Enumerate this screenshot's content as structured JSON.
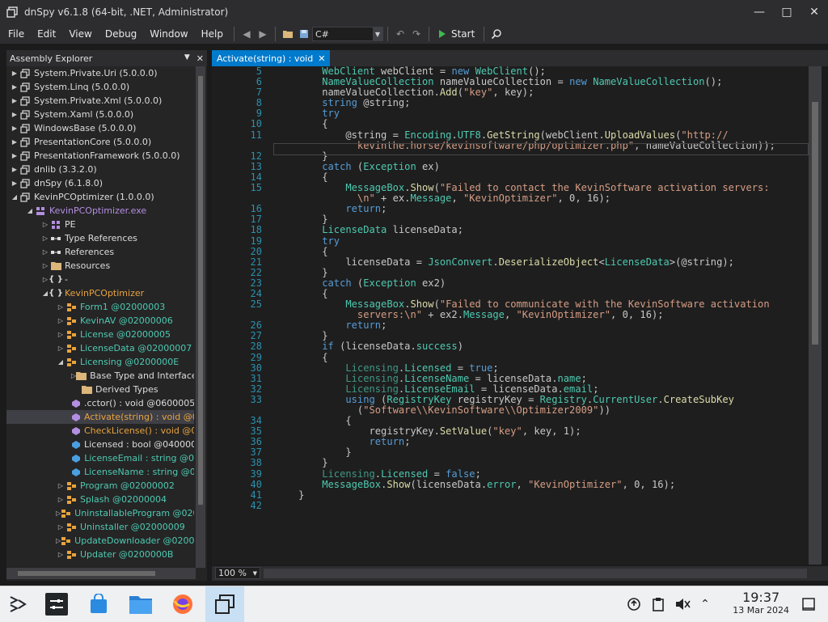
{
  "window": {
    "title": "dnSpy v6.1.8 (64-bit, .NET, Administrator)"
  },
  "menu": [
    "File",
    "Edit",
    "View",
    "Debug",
    "Window",
    "Help"
  ],
  "toolbar": {
    "language": "C#",
    "start_label": "Start"
  },
  "explorer": {
    "title": "Assembly Explorer",
    "items": [
      {
        "label": "System.Private.Uri (5.0.0.0)",
        "depth": 0,
        "arrow": "▶",
        "icon": "assembly-icon",
        "color": "#dcdcdc"
      },
      {
        "label": "System.Linq (5.0.0.0)",
        "depth": 0,
        "arrow": "▶",
        "icon": "assembly-icon",
        "color": "#dcdcdc"
      },
      {
        "label": "System.Private.Xml (5.0.0.0)",
        "depth": 0,
        "arrow": "▶",
        "icon": "assembly-icon",
        "color": "#dcdcdc"
      },
      {
        "label": "System.Xaml (5.0.0.0)",
        "depth": 0,
        "arrow": "▶",
        "icon": "assembly-icon",
        "color": "#dcdcdc"
      },
      {
        "label": "WindowsBase (5.0.0.0)",
        "depth": 0,
        "arrow": "▶",
        "icon": "assembly-icon",
        "color": "#dcdcdc"
      },
      {
        "label": "PresentationCore (5.0.0.0)",
        "depth": 0,
        "arrow": "▶",
        "icon": "assembly-icon",
        "color": "#dcdcdc"
      },
      {
        "label": "PresentationFramework (5.0.0.0)",
        "depth": 0,
        "arrow": "▶",
        "icon": "assembly-icon",
        "color": "#dcdcdc"
      },
      {
        "label": "dnlib (3.3.2.0)",
        "depth": 0,
        "arrow": "▶",
        "icon": "assembly-icon",
        "color": "#dcdcdc"
      },
      {
        "label": "dnSpy (6.1.8.0)",
        "depth": 0,
        "arrow": "▶",
        "icon": "assembly-icon",
        "color": "#dcdcdc"
      },
      {
        "label": "KevinPCOptimizer (1.0.0.0)",
        "depth": 0,
        "arrow": "◢",
        "icon": "assembly-icon",
        "color": "#dcdcdc"
      },
      {
        "label": "KevinPCOptimizer.exe",
        "depth": 1,
        "arrow": "◢",
        "icon": "module-icon",
        "color": "#b48ee0"
      },
      {
        "label": "PE",
        "depth": 2,
        "arrow": "▷",
        "icon": "pe-icon",
        "color": "#dcdcdc"
      },
      {
        "label": "Type References",
        "depth": 2,
        "arrow": "▷",
        "icon": "references-icon",
        "color": "#dcdcdc"
      },
      {
        "label": "References",
        "depth": 2,
        "arrow": "▷",
        "icon": "references-icon",
        "color": "#dcdcdc"
      },
      {
        "label": "Resources",
        "depth": 2,
        "arrow": "▷",
        "icon": "folder-icon",
        "color": "#dcdcdc"
      },
      {
        "label": "-",
        "depth": 2,
        "arrow": "▷",
        "icon": "namespace-icon",
        "color": "#dcdcdc"
      },
      {
        "label": "KevinPCOptimizer",
        "depth": 2,
        "arrow": "◢",
        "icon": "namespace-icon",
        "color": "#e8a33d"
      },
      {
        "label": "Form1 @02000003",
        "depth": 3,
        "arrow": "▷",
        "icon": "class-icon",
        "color": "#4ec9b0"
      },
      {
        "label": "KevinAV @02000006",
        "depth": 3,
        "arrow": "▷",
        "icon": "class-icon",
        "color": "#4ec9b0"
      },
      {
        "label": "License @02000005",
        "depth": 3,
        "arrow": "▷",
        "icon": "class-icon",
        "color": "#4ec9b0"
      },
      {
        "label": "LicenseData @02000007",
        "depth": 3,
        "arrow": "▷",
        "icon": "class-icon",
        "color": "#4ec9b0"
      },
      {
        "label": "Licensing @0200000E",
        "depth": 3,
        "arrow": "◢",
        "icon": "class-icon",
        "color": "#4ec9b0"
      },
      {
        "label": "Base Type and Interfaces",
        "depth": 4,
        "arrow": "▷",
        "icon": "folder-icon",
        "color": "#dcdcdc"
      },
      {
        "label": "Derived Types",
        "depth": 4,
        "arrow": "",
        "icon": "folder-icon",
        "color": "#dcdcdc"
      },
      {
        "label": ".cctor() : void @0600005",
        "depth": 4,
        "arrow": "",
        "icon": "method-icon",
        "color": "#dcdcdc"
      },
      {
        "label": "Activate(string) : void @0",
        "depth": 4,
        "arrow": "",
        "icon": "method-icon",
        "color": "#e8a33d",
        "selected": true
      },
      {
        "label": "CheckLicense() : void @0",
        "depth": 4,
        "arrow": "",
        "icon": "method-icon",
        "color": "#e8a33d"
      },
      {
        "label": "Licensed : bool @040000",
        "depth": 4,
        "arrow": "",
        "icon": "field-icon",
        "color": "#dcdcdc"
      },
      {
        "label": "LicenseEmail : string @0",
        "depth": 4,
        "arrow": "",
        "icon": "field-icon",
        "color": "#4ec9b0"
      },
      {
        "label": "LicenseName : string @0",
        "depth": 4,
        "arrow": "",
        "icon": "field-icon",
        "color": "#4ec9b0"
      },
      {
        "label": "Program @02000002",
        "depth": 3,
        "arrow": "▷",
        "icon": "class-icon",
        "color": "#4ec9b0"
      },
      {
        "label": "Splash @02000004",
        "depth": 3,
        "arrow": "▷",
        "icon": "class-icon",
        "color": "#4ec9b0"
      },
      {
        "label": "UninstallableProgram @0200",
        "depth": 3,
        "arrow": "▷",
        "icon": "class-icon",
        "color": "#4ec9b0"
      },
      {
        "label": "Uninstaller @02000009",
        "depth": 3,
        "arrow": "▷",
        "icon": "class-icon",
        "color": "#4ec9b0"
      },
      {
        "label": "UpdateDownloader @02000",
        "depth": 3,
        "arrow": "▷",
        "icon": "class-icon",
        "color": "#4ec9b0"
      },
      {
        "label": "Updater @0200000B",
        "depth": 3,
        "arrow": "▷",
        "icon": "class-icon",
        "color": "#4ec9b0"
      }
    ]
  },
  "tab": {
    "label": "Activate(string) : void"
  },
  "editor": {
    "line_numbers": [
      "5",
      "6",
      "7",
      "8",
      "9",
      "10",
      "11",
      "",
      "12",
      "13",
      "14",
      "15",
      "",
      "16",
      "17",
      "18",
      "19",
      "20",
      "21",
      "22",
      "23",
      "24",
      "25",
      "",
      "26",
      "27",
      "28",
      "29",
      "30",
      "31",
      "32",
      "33",
      "",
      "34",
      "35",
      "36",
      "37",
      "38",
      "39",
      "40",
      "41",
      "42"
    ],
    "lines": [
      [
        [
          "t",
          "        WebClient"
        ],
        [
          "p",
          " webClient = "
        ],
        [
          "k",
          "new"
        ],
        [
          "p",
          " "
        ],
        [
          "t",
          "WebClient"
        ],
        [
          "p",
          "();"
        ]
      ],
      [
        [
          "t",
          "        NameValueCollection"
        ],
        [
          "p",
          " nameValueCollection = "
        ],
        [
          "k",
          "new"
        ],
        [
          "p",
          " "
        ],
        [
          "t",
          "NameValueCollection"
        ],
        [
          "p",
          "();"
        ]
      ],
      [
        [
          "p",
          "        nameValueCollection."
        ],
        [
          "m",
          "Add"
        ],
        [
          "p",
          "("
        ],
        [
          "s",
          "\"key\""
        ],
        [
          "p",
          ", key);"
        ]
      ],
      [
        [
          "k",
          "        string"
        ],
        [
          "p",
          " @string;"
        ]
      ],
      [
        [
          "k",
          "        try"
        ]
      ],
      [
        [
          "p",
          "        {"
        ]
      ],
      [
        [
          "p",
          "            @string = "
        ],
        [
          "t",
          "Encoding"
        ],
        [
          "p",
          "."
        ],
        [
          "t",
          "UTF8"
        ],
        [
          "p",
          "."
        ],
        [
          "m",
          "GetString"
        ],
        [
          "p",
          "(webClient."
        ],
        [
          "m",
          "UploadValues"
        ],
        [
          "p",
          "("
        ],
        [
          "s",
          "\"http://"
        ]
      ],
      [
        [
          "s",
          "              kevinthe.horse/kevinsoftware/php/optimizer.php\""
        ],
        [
          "p",
          ", nameValueCollection));"
        ]
      ],
      [
        [
          "p",
          "        }"
        ]
      ],
      [
        [
          "k",
          "        catch"
        ],
        [
          "p",
          " ("
        ],
        [
          "t",
          "Exception"
        ],
        [
          "p",
          " ex)"
        ]
      ],
      [
        [
          "p",
          "        {"
        ]
      ],
      [
        [
          "t",
          "            MessageBox"
        ],
        [
          "p",
          "."
        ],
        [
          "m",
          "Show"
        ],
        [
          "p",
          "("
        ],
        [
          "s",
          "\"Failed to contact the KevinSoftware activation servers:"
        ]
      ],
      [
        [
          "s",
          "              \\n\""
        ],
        [
          "p",
          " + ex."
        ],
        [
          "t",
          "Message"
        ],
        [
          "p",
          ", "
        ],
        [
          "s",
          "\"KevinOptimizer\""
        ],
        [
          "p",
          ", 0, 16);"
        ]
      ],
      [
        [
          "k",
          "            return"
        ],
        [
          "p",
          ";"
        ]
      ],
      [
        [
          "p",
          "        }"
        ]
      ],
      [
        [
          "t",
          "        LicenseData"
        ],
        [
          "p",
          " licenseData;"
        ]
      ],
      [
        [
          "k",
          "        try"
        ]
      ],
      [
        [
          "p",
          "        {"
        ]
      ],
      [
        [
          "p",
          "            licenseData = "
        ],
        [
          "t",
          "JsonConvert"
        ],
        [
          "p",
          "."
        ],
        [
          "m",
          "DeserializeObject"
        ],
        [
          "p",
          "<"
        ],
        [
          "t",
          "LicenseData"
        ],
        [
          "p",
          ">(@string);"
        ]
      ],
      [
        [
          "p",
          "        }"
        ]
      ],
      [
        [
          "k",
          "        catch"
        ],
        [
          "p",
          " ("
        ],
        [
          "t",
          "Exception"
        ],
        [
          "p",
          " ex2)"
        ]
      ],
      [
        [
          "p",
          "        {"
        ]
      ],
      [
        [
          "t",
          "            MessageBox"
        ],
        [
          "p",
          "."
        ],
        [
          "m",
          "Show"
        ],
        [
          "p",
          "("
        ],
        [
          "s",
          "\"Failed to communicate with the KevinSoftware activation"
        ]
      ],
      [
        [
          "s",
          "              servers:\\n\""
        ],
        [
          "p",
          " + ex2."
        ],
        [
          "t",
          "Message"
        ],
        [
          "p",
          ", "
        ],
        [
          "s",
          "\"KevinOptimizer\""
        ],
        [
          "p",
          ", 0, 16);"
        ]
      ],
      [
        [
          "k",
          "            return"
        ],
        [
          "p",
          ";"
        ]
      ],
      [
        [
          "p",
          "        }"
        ]
      ],
      [
        [
          "k",
          "        if"
        ],
        [
          "p",
          " (licenseData."
        ],
        [
          "t",
          "success"
        ],
        [
          "p",
          ")"
        ]
      ],
      [
        [
          "p",
          "        {"
        ]
      ],
      [
        [
          "st",
          "            Licensing"
        ],
        [
          "p",
          "."
        ],
        [
          "t",
          "Licensed"
        ],
        [
          "p",
          " = "
        ],
        [
          "k",
          "true"
        ],
        [
          "p",
          ";"
        ]
      ],
      [
        [
          "st",
          "            Licensing"
        ],
        [
          "p",
          "."
        ],
        [
          "t",
          "LicenseName"
        ],
        [
          "p",
          " = licenseData."
        ],
        [
          "t",
          "name"
        ],
        [
          "p",
          ";"
        ]
      ],
      [
        [
          "st",
          "            Licensing"
        ],
        [
          "p",
          "."
        ],
        [
          "t",
          "LicenseEmail"
        ],
        [
          "p",
          " = licenseData."
        ],
        [
          "t",
          "email"
        ],
        [
          "p",
          ";"
        ]
      ],
      [
        [
          "k",
          "            using"
        ],
        [
          "p",
          " ("
        ],
        [
          "t",
          "RegistryKey"
        ],
        [
          "p",
          " registryKey = "
        ],
        [
          "t",
          "Registry"
        ],
        [
          "p",
          "."
        ],
        [
          "t",
          "CurrentUser"
        ],
        [
          "p",
          "."
        ],
        [
          "m",
          "CreateSubKey"
        ]
      ],
      [
        [
          "p",
          "              ("
        ],
        [
          "s",
          "\"Software\\\\KevinSoftware\\\\Optimizer2009\""
        ],
        [
          "p",
          "))"
        ]
      ],
      [
        [
          "p",
          "            {"
        ]
      ],
      [
        [
          "p",
          "                registryKey."
        ],
        [
          "m",
          "SetValue"
        ],
        [
          "p",
          "("
        ],
        [
          "s",
          "\"key\""
        ],
        [
          "p",
          ", key, 1);"
        ]
      ],
      [
        [
          "k",
          "                return"
        ],
        [
          "p",
          ";"
        ]
      ],
      [
        [
          "p",
          "            }"
        ]
      ],
      [
        [
          "p",
          "        }"
        ]
      ],
      [
        [
          "st",
          "        Licensing"
        ],
        [
          "p",
          "."
        ],
        [
          "t",
          "Licensed"
        ],
        [
          "p",
          " = "
        ],
        [
          "k",
          "false"
        ],
        [
          "p",
          ";"
        ]
      ],
      [
        [
          "t",
          "        MessageBox"
        ],
        [
          "p",
          "."
        ],
        [
          "m",
          "Show"
        ],
        [
          "p",
          "(licenseData."
        ],
        [
          "t",
          "error"
        ],
        [
          "p",
          ", "
        ],
        [
          "s",
          "\"KevinOptimizer\""
        ],
        [
          "p",
          ", 0, 16);"
        ]
      ],
      [
        [
          "p",
          "    }"
        ]
      ],
      [
        [
          "p",
          ""
        ]
      ]
    ]
  },
  "status": {
    "zoom": "100 %"
  },
  "taskbar": {
    "time": "19:37",
    "date": "13 Mar 2024"
  },
  "colors": {
    "accent": "#007acc",
    "keyword": "#569cd6",
    "type": "#4ec9b0",
    "string": "#d69d85",
    "method": "#dcdcaa"
  }
}
